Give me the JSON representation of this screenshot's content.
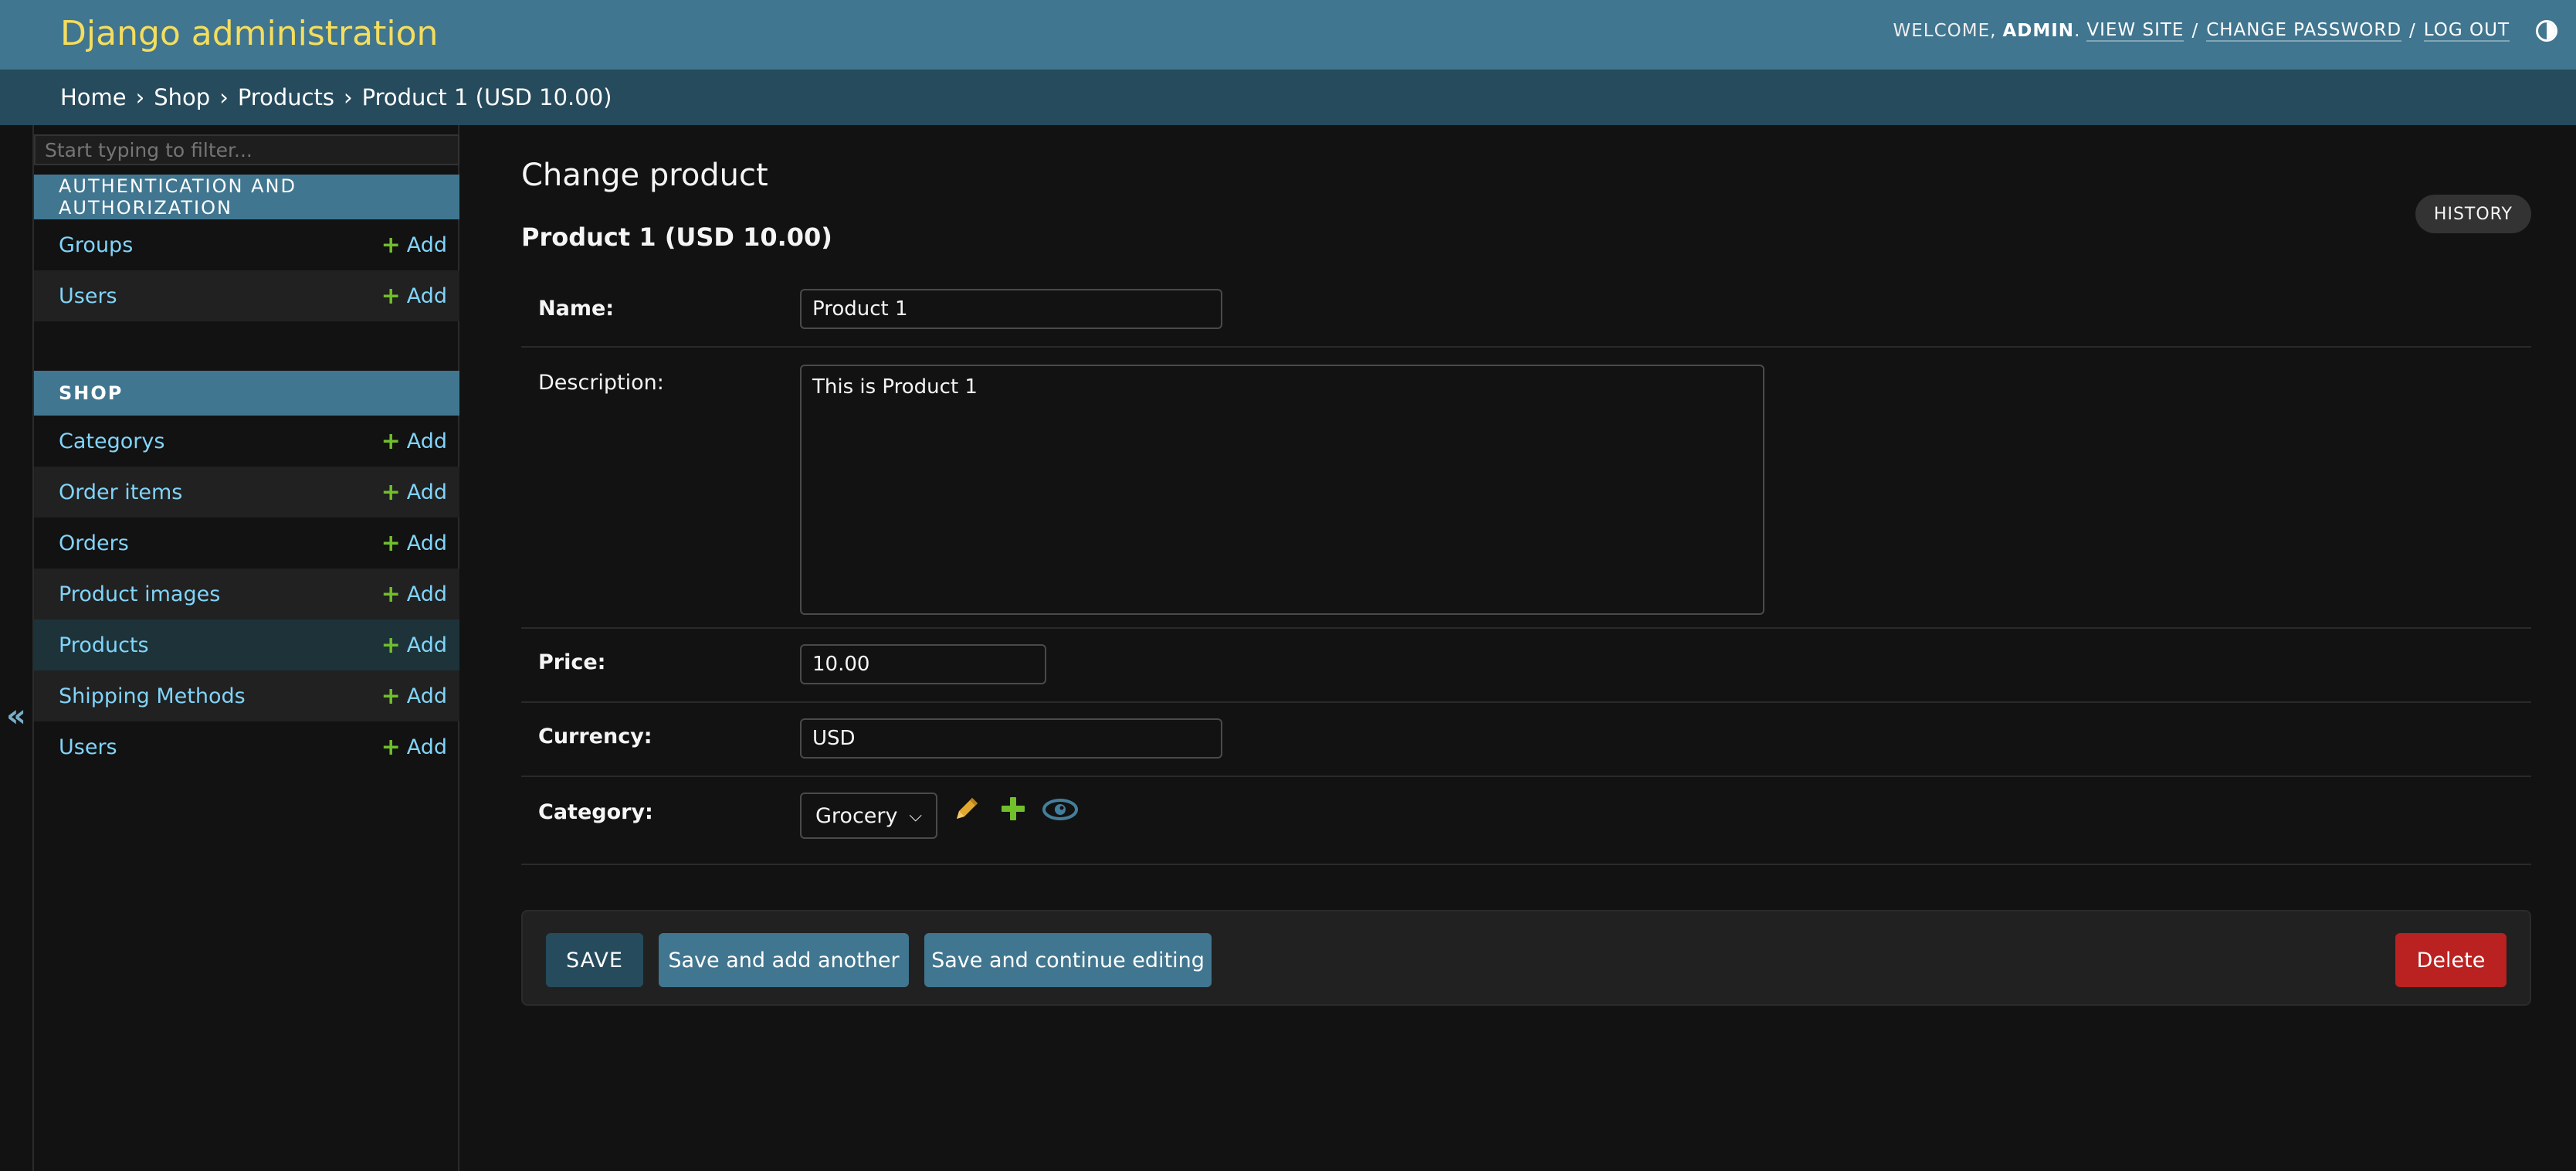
{
  "header": {
    "site_title": "Django administration",
    "welcome": "Welcome,",
    "username": "admin",
    "links": {
      "view_site": "View site",
      "change_password": "Change password",
      "log_out": "Log out"
    },
    "separator": "/"
  },
  "breadcrumbs": {
    "items": [
      "Home",
      "Shop",
      "Products"
    ],
    "current": "Product 1 (USD 10.00)",
    "separator": "›"
  },
  "sidebar": {
    "filter_placeholder": "Start typing to filter...",
    "collapse_glyph": "«",
    "add_label": "Add",
    "modules": [
      {
        "caption": "Authentication and Authorization",
        "models": [
          {
            "name": "Groups"
          },
          {
            "name": "Users"
          }
        ]
      },
      {
        "caption": "Shop",
        "models": [
          {
            "name": "Categorys"
          },
          {
            "name": "Order items"
          },
          {
            "name": "Orders"
          },
          {
            "name": "Product images"
          },
          {
            "name": "Products",
            "current": true
          },
          {
            "name": "Shipping Methods"
          },
          {
            "name": "Users"
          }
        ]
      }
    ]
  },
  "main": {
    "heading": "Change product",
    "history_label": "History",
    "object_title": "Product 1 (USD 10.00)",
    "fields": {
      "name": {
        "label": "Name:",
        "value": "Product 1"
      },
      "description": {
        "label": "Description:",
        "value": "This is Product 1"
      },
      "price": {
        "label": "Price:",
        "value": "10.00"
      },
      "currency": {
        "label": "Currency:",
        "value": "USD"
      },
      "category": {
        "label": "Category:",
        "value": "Grocery"
      }
    },
    "buttons": {
      "save": "SAVE",
      "save_add_another": "Save and add another",
      "save_continue": "Save and continue editing",
      "delete": "Delete"
    }
  },
  "colors": {
    "header_bg": "#417690",
    "breadcrumb_bg": "#264b5d",
    "accent_yellow": "#f5dd5d",
    "link_blue": "#81d4fa",
    "add_green": "#70bf2b",
    "delete_red": "#ba2121"
  }
}
